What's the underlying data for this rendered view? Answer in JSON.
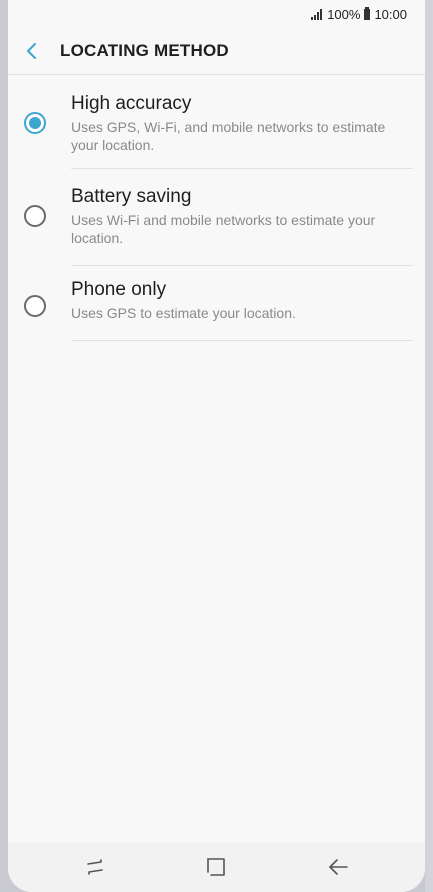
{
  "status_bar": {
    "battery": "100%",
    "time": "10:00"
  },
  "header": {
    "title": "LOCATING METHOD",
    "back_icon": "chevron-left-icon"
  },
  "options": [
    {
      "title": "High accuracy",
      "description": "Uses GPS, Wi-Fi, and mobile networks to estimate your location.",
      "selected": true
    },
    {
      "title": "Battery saving",
      "description": "Uses Wi-Fi and mobile networks to estimate your location.",
      "selected": false
    },
    {
      "title": "Phone only",
      "description": "Uses GPS to estimate your location.",
      "selected": false
    }
  ],
  "colors": {
    "accent": "#3ea5cf",
    "background": "#f8f8f8"
  },
  "nav_bar": {
    "recents_icon": "recents-icon",
    "home_icon": "home-icon",
    "back_icon": "back-arrow-icon"
  }
}
